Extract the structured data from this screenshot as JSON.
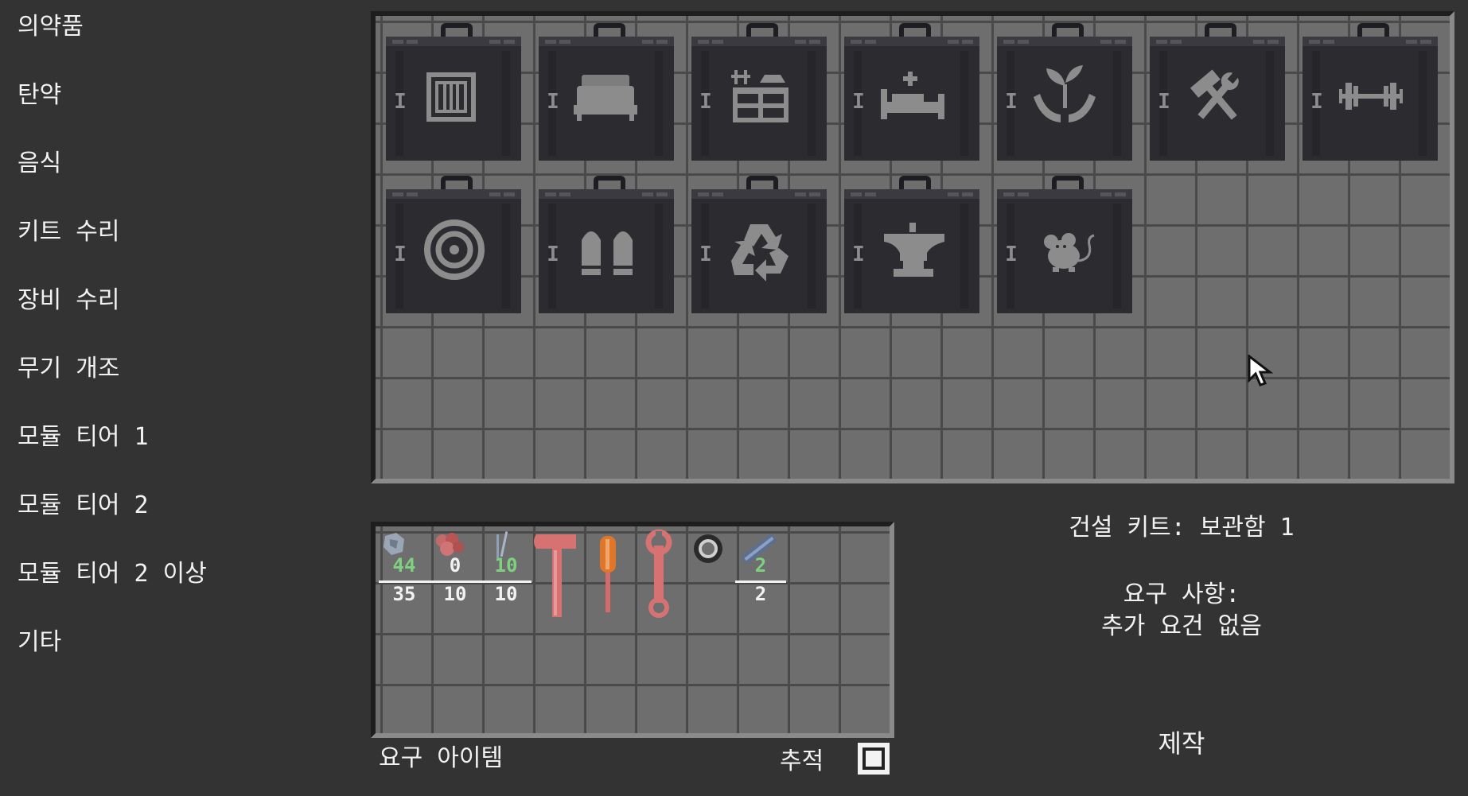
{
  "categories": [
    {
      "label": "의약품"
    },
    {
      "label": "탄약"
    },
    {
      "label": "음식"
    },
    {
      "label": "키트 수리"
    },
    {
      "label": "장비 수리"
    },
    {
      "label": "무기 개조"
    },
    {
      "label": "모듈 티어 1"
    },
    {
      "label": "모듈 티어 2"
    },
    {
      "label": "모듈 티어 2 이상"
    },
    {
      "label": "기타"
    }
  ],
  "kits": [
    {
      "icon": "storage-locker-icon",
      "tier": "I"
    },
    {
      "icon": "bed-icon",
      "tier": "I"
    },
    {
      "icon": "kitchen-stove-icon",
      "tier": "I"
    },
    {
      "icon": "medical-bed-icon",
      "tier": "I"
    },
    {
      "icon": "plant-hands-icon",
      "tier": "I"
    },
    {
      "icon": "hammer-wrench-icon",
      "tier": "I"
    },
    {
      "icon": "dumbbell-icon",
      "tier": "I"
    },
    {
      "icon": "target-icon",
      "tier": "I"
    },
    {
      "icon": "bullets-icon",
      "tier": "I"
    },
    {
      "icon": "recycle-icon",
      "tier": "I"
    },
    {
      "icon": "anvil-icon",
      "tier": "I"
    },
    {
      "icon": "mouse-icon",
      "tier": "I"
    }
  ],
  "required_items": [
    {
      "icon": "scrap-metal-icon",
      "have": "44",
      "need": "35",
      "have_color": "#7fd17f"
    },
    {
      "icon": "red-parts-icon",
      "have": "0",
      "need": "10",
      "have_color": "#f2f2f2"
    },
    {
      "icon": "nails-icon",
      "have": "10",
      "need": "10",
      "have_color": "#7fd17f"
    },
    {
      "icon": "hammer-icon"
    },
    {
      "icon": "screwdriver-icon"
    },
    {
      "icon": "wrench-icon"
    },
    {
      "icon": "duct-tape-icon"
    },
    {
      "icon": "metal-pipe-icon",
      "have": "2",
      "need": "2",
      "have_color": "#7fd17f"
    }
  ],
  "info": {
    "kit_name": "건설 키트: 보관함 1",
    "requirements_title": "요구 사항:",
    "requirements_value": "추가 요건 없음"
  },
  "labels": {
    "required_items": "요구 아이템",
    "track": "추적",
    "craft": "제작"
  },
  "colors": {
    "background": "#333333",
    "slot": "#6e6e6e",
    "kit_case": "#2c2c30",
    "kit_icon": "#8c8c8c"
  }
}
